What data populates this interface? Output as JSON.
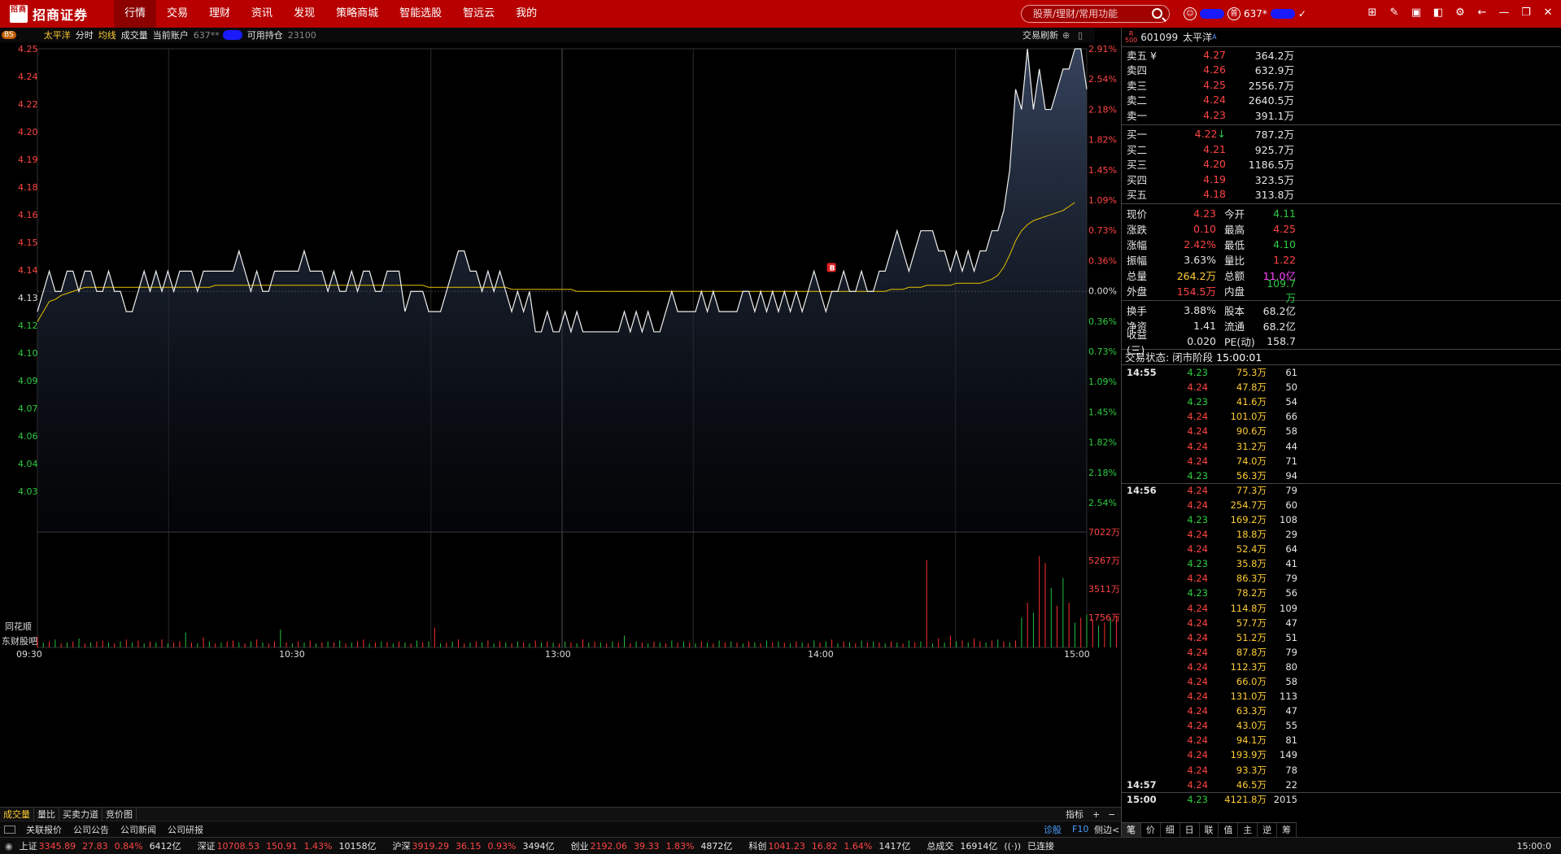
{
  "app": {
    "brand": "招商证券",
    "logo_text": "招商"
  },
  "menu": [
    "行情",
    "交易",
    "理财",
    "资讯",
    "发现",
    "策略商城",
    "智能选股",
    "智远云",
    "我的"
  ],
  "search": {
    "placeholder": "股票/理财/常用功能"
  },
  "account": {
    "id_prefix": "637*"
  },
  "infobar": {
    "stock": "太平洋",
    "items": [
      "分时",
      "均线",
      "成交量"
    ],
    "account_label": "当前账户",
    "account_prefix": "637**",
    "holding_label": "可用持仓",
    "holding": "23100",
    "refresh": "交易刷新",
    "bs": "BS"
  },
  "chart_data": {
    "type": "line",
    "title": "",
    "x_ticks": [
      "09:30",
      "10:30",
      "13:00",
      "14:00",
      "15:00"
    ],
    "y_left_ticks": [
      "4.25",
      "4.24",
      "4.22",
      "4.20",
      "4.19",
      "4.18",
      "4.16",
      "4.15",
      "4.14",
      "4.13",
      "4.12",
      "4.10",
      "4.09",
      "4.07",
      "4.06",
      "4.04",
      "4.03"
    ],
    "y_right_ticks": [
      "2.91%",
      "2.54%",
      "2.18%",
      "1.82%",
      "1.45%",
      "1.09%",
      "0.73%",
      "0.36%",
      "0.00%",
      "0.36%",
      "0.73%",
      "1.09%",
      "1.45%",
      "1.82%",
      "2.18%",
      "2.54%"
    ],
    "vol_ticks": [
      "7022万",
      "5267万",
      "3511万",
      "1756万"
    ],
    "prev_close": 4.13,
    "ylim": [
      4.011,
      4.25
    ],
    "price": [
      4.12,
      4.13,
      4.14,
      4.13,
      4.13,
      4.14,
      4.14,
      4.13,
      4.14,
      4.14,
      4.13,
      4.13,
      4.14,
      4.13,
      4.13,
      4.12,
      4.12,
      4.13,
      4.14,
      4.13,
      4.14,
      4.13,
      4.14,
      4.13,
      4.14,
      4.14,
      4.14,
      4.13,
      4.14,
      4.14,
      4.14,
      4.14,
      4.14,
      4.14,
      4.15,
      4.14,
      4.13,
      4.14,
      4.13,
      4.13,
      4.14,
      4.14,
      4.14,
      4.14,
      4.14,
      4.15,
      4.14,
      4.14,
      4.14,
      4.13,
      4.14,
      4.13,
      4.13,
      4.14,
      4.13,
      4.14,
      4.14,
      4.13,
      4.13,
      4.14,
      4.14,
      4.14,
      4.12,
      4.13,
      4.13,
      4.13,
      4.12,
      4.12,
      4.12,
      4.13,
      4.14,
      4.15,
      4.15,
      4.14,
      4.14,
      4.13,
      4.14,
      4.13,
      4.14,
      4.13,
      4.12,
      4.13,
      4.12,
      4.13,
      4.11,
      4.11,
      4.12,
      4.11,
      4.11,
      4.12,
      4.11,
      4.12,
      4.11,
      4.11,
      4.11,
      4.11,
      4.11,
      4.11,
      4.11,
      4.12,
      4.11,
      4.12,
      4.11,
      4.12,
      4.11,
      4.11,
      4.12,
      4.13,
      4.12,
      4.12,
      4.12,
      4.12,
      4.13,
      4.12,
      4.13,
      4.12,
      4.12,
      4.12,
      4.12,
      4.13,
      4.13,
      4.12,
      4.13,
      4.12,
      4.13,
      4.12,
      4.13,
      4.12,
      4.13,
      4.12,
      4.13,
      4.14,
      4.13,
      4.12,
      4.13,
      4.13,
      4.14,
      4.13,
      4.13,
      4.14,
      4.13,
      4.13,
      4.14,
      4.14,
      4.15,
      4.16,
      4.15,
      4.14,
      4.15,
      4.16,
      4.16,
      4.16,
      4.15,
      4.15,
      4.14,
      4.15,
      4.14,
      4.15,
      4.14,
      4.15,
      4.15,
      4.16,
      4.16,
      4.17,
      4.19,
      4.23,
      4.22,
      4.25,
      4.22,
      4.24,
      4.22,
      4.22,
      4.23,
      4.24,
      4.24,
      4.25,
      4.25,
      4.23
    ],
    "avg": [
      4.115,
      4.12,
      4.125,
      4.126,
      4.128,
      4.129,
      4.13,
      4.131,
      4.132,
      4.132,
      4.132,
      4.132,
      4.132,
      4.132,
      4.132,
      4.132,
      4.132,
      4.132,
      4.132,
      4.132,
      4.132,
      4.132,
      4.132,
      4.132,
      4.132,
      4.132,
      4.132,
      4.132,
      4.132,
      4.132,
      4.133,
      4.133,
      4.133,
      4.133,
      4.133,
      4.133,
      4.133,
      4.133,
      4.133,
      4.133,
      4.133,
      4.133,
      4.133,
      4.133,
      4.133,
      4.133,
      4.133,
      4.133,
      4.133,
      4.133,
      4.133,
      4.133,
      4.133,
      4.133,
      4.133,
      4.133,
      4.133,
      4.133,
      4.133,
      4.133,
      4.133,
      4.133,
      4.133,
      4.133,
      4.133,
      4.133,
      4.132,
      4.132,
      4.132,
      4.132,
      4.132,
      4.132,
      4.132,
      4.132,
      4.132,
      4.132,
      4.132,
      4.132,
      4.132,
      4.132,
      4.131,
      4.131,
      4.131,
      4.131,
      4.131,
      4.131,
      4.131,
      4.131,
      4.131,
      4.131,
      4.131,
      4.13,
      4.13,
      4.13,
      4.13,
      4.13,
      4.13,
      4.13,
      4.13,
      4.13,
      4.13,
      4.13,
      4.13,
      4.13,
      4.13,
      4.13,
      4.13,
      4.13,
      4.13,
      4.13,
      4.13,
      4.13,
      4.13,
      4.13,
      4.13,
      4.13,
      4.13,
      4.13,
      4.13,
      4.13,
      4.13,
      4.13,
      4.13,
      4.13,
      4.13,
      4.13,
      4.13,
      4.13,
      4.13,
      4.13,
      4.13,
      4.13,
      4.13,
      4.13,
      4.13,
      4.13,
      4.13,
      4.13,
      4.13,
      4.13,
      4.13,
      4.13,
      4.13,
      4.13,
      4.131,
      4.131,
      4.131,
      4.132,
      4.132,
      4.132,
      4.133,
      4.133,
      4.133,
      4.133,
      4.133,
      4.134,
      4.134,
      4.134,
      4.134,
      4.134,
      4.135,
      4.136,
      4.138,
      4.142,
      4.148,
      4.155,
      4.16,
      4.163,
      4.165,
      4.166,
      4.167,
      4.168,
      4.169,
      4.17,
      4.172,
      4.174
    ],
    "volume": [
      0.11,
      0.05,
      0.06,
      0.08,
      0.04,
      0.05,
      0.06,
      0.09,
      0.04,
      0.05,
      0.06,
      0.07,
      0.05,
      0.04,
      0.06,
      0.08,
      0.05,
      0.07,
      0.04,
      0.06,
      0.05,
      0.08,
      0.04,
      0.05,
      0.06,
      0.15,
      0.05,
      0.04,
      0.1,
      0.06,
      0.04,
      0.05,
      0.06,
      0.07,
      0.05,
      0.04,
      0.06,
      0.08,
      0.05,
      0.04,
      0.06,
      0.18,
      0.05,
      0.04,
      0.06,
      0.05,
      0.07,
      0.04,
      0.05,
      0.06,
      0.05,
      0.07,
      0.04,
      0.05,
      0.06,
      0.08,
      0.04,
      0.05,
      0.06,
      0.05,
      0.04,
      0.06,
      0.05,
      0.04,
      0.07,
      0.05,
      0.06,
      0.2,
      0.04,
      0.05,
      0.06,
      0.08,
      0.04,
      0.05,
      0.06,
      0.05,
      0.07,
      0.04,
      0.06,
      0.05,
      0.04,
      0.06,
      0.05,
      0.04,
      0.07,
      0.05,
      0.06,
      0.05,
      0.04,
      0.06,
      0.05,
      0.04,
      0.08,
      0.05,
      0.06,
      0.05,
      0.04,
      0.06,
      0.05,
      0.12,
      0.04,
      0.06,
      0.05,
      0.04,
      0.06,
      0.05,
      0.04,
      0.07,
      0.05,
      0.06,
      0.05,
      0.04,
      0.06,
      0.05,
      0.04,
      0.07,
      0.05,
      0.06,
      0.05,
      0.04,
      0.06,
      0.05,
      0.04,
      0.07,
      0.05,
      0.06,
      0.05,
      0.04,
      0.06,
      0.05,
      0.04,
      0.07,
      0.05,
      0.06,
      0.08,
      0.04,
      0.06,
      0.05,
      0.04,
      0.07,
      0.05,
      0.06,
      0.05,
      0.04,
      0.06,
      0.05,
      0.04,
      0.07,
      0.05,
      0.06,
      0.88,
      0.04,
      0.09,
      0.05,
      0.12,
      0.06,
      0.07,
      0.05,
      0.09,
      0.06,
      0.05,
      0.07,
      0.08,
      0.06,
      0.05,
      0.07,
      0.3,
      0.45,
      0.35,
      0.92,
      0.85,
      0.6,
      0.42,
      0.7,
      0.45,
      0.25,
      0.3,
      0.33,
      0.28,
      0.22,
      0.25,
      0.3,
      0.32
    ],
    "vol_up": [
      1,
      0,
      1,
      0,
      1,
      0,
      1,
      0,
      1,
      0,
      1,
      1,
      0,
      1,
      0,
      1,
      0,
      1,
      0,
      1,
      0,
      1,
      0,
      1,
      1,
      0,
      1,
      0,
      1,
      0,
      1,
      0,
      1,
      1,
      0,
      1,
      0,
      1,
      0,
      1,
      1,
      0,
      1,
      0,
      1,
      0,
      1,
      0,
      1,
      0,
      1,
      0,
      1,
      0,
      1,
      1,
      0,
      1,
      0,
      1,
      0,
      1,
      0,
      1,
      0,
      1,
      0,
      1,
      0,
      1,
      0,
      1,
      1,
      0,
      1,
      0,
      1,
      0,
      1,
      0,
      1,
      0,
      1,
      0,
      1,
      0,
      1,
      0,
      1,
      0,
      1,
      0,
      1,
      0,
      1,
      0,
      1,
      0,
      1,
      0,
      1,
      0,
      1,
      0,
      1,
      0,
      1,
      0,
      1,
      0,
      1,
      0,
      1,
      0,
      1,
      0,
      1,
      0,
      1,
      0,
      1,
      0,
      1,
      0,
      1,
      0,
      1,
      0,
      1,
      0,
      1,
      0,
      1,
      0,
      1,
      0,
      1,
      0,
      1,
      0,
      1,
      0,
      1,
      0,
      1,
      0,
      1,
      0,
      1,
      0,
      1,
      0,
      1,
      0,
      1,
      0,
      1,
      0,
      1,
      1,
      0,
      1,
      0,
      1,
      0,
      1,
      0,
      1,
      0,
      1,
      1,
      0,
      1,
      0,
      1,
      0,
      1,
      0,
      1,
      0,
      1,
      0,
      1
    ],
    "marker": "B"
  },
  "left_side": [
    "同花顺",
    "东财股吧"
  ],
  "bottom_tabs": [
    "成交量",
    "量比",
    "买卖力道",
    "竞价图"
  ],
  "bottom_right": {
    "label": "指标",
    "plus": "+",
    "minus": "−"
  },
  "bottom_tabs2": [
    "关联报价",
    "公司公告",
    "公司新闻",
    "公司研报"
  ],
  "bottom_right2": [
    "诊股",
    "F10",
    "侧边<"
  ],
  "stock": {
    "code": "601099",
    "name": "太平洋",
    "flag": "A",
    "badge": "R",
    "badge2": "500"
  },
  "asks": [
    {
      "label": "卖五 ¥",
      "price": "4.27",
      "vol": "364.2万"
    },
    {
      "label": "卖四",
      "price": "4.26",
      "vol": "632.9万"
    },
    {
      "label": "卖三",
      "price": "4.25",
      "vol": "2556.7万"
    },
    {
      "label": "卖二",
      "price": "4.24",
      "vol": "2640.5万"
    },
    {
      "label": "卖一",
      "price": "4.23",
      "vol": "391.1万"
    }
  ],
  "bids": [
    {
      "label": "买一",
      "price": "4.22",
      "vol": "787.2万",
      "arrow": "↓"
    },
    {
      "label": "买二",
      "price": "4.21",
      "vol": "925.7万",
      "arrow": ""
    },
    {
      "label": "买三",
      "price": "4.20",
      "vol": "1186.5万",
      "arrow": ""
    },
    {
      "label": "买四",
      "price": "4.19",
      "vol": "323.5万",
      "arrow": ""
    },
    {
      "label": "买五",
      "price": "4.18",
      "vol": "313.8万",
      "arrow": ""
    }
  ],
  "quote1": [
    {
      "k1": "现价",
      "v1": "4.23",
      "c1": "red",
      "k2": "今开",
      "v2": "4.11",
      "c2": "grn"
    },
    {
      "k1": "涨跌",
      "v1": "0.10",
      "c1": "red",
      "k2": "最高",
      "v2": "4.25",
      "c2": "red"
    },
    {
      "k1": "涨幅",
      "v1": "2.42%",
      "c1": "red",
      "k2": "最低",
      "v2": "4.10",
      "c2": "grn"
    },
    {
      "k1": "振幅",
      "v1": "3.63%",
      "c1": "wht",
      "k2": "量比",
      "v2": "1.22",
      "c2": "red"
    },
    {
      "k1": "总量",
      "v1": "264.2万",
      "c1": "yel",
      "k2": "总额",
      "v2": "11.0亿",
      "c2": "pur"
    },
    {
      "k1": "外盘",
      "v1": "154.5万",
      "c1": "red",
      "k2": "内盘",
      "v2": "109.7万",
      "c2": "grn"
    }
  ],
  "quote2": [
    {
      "k1": "换手",
      "v1": "3.88%",
      "c1": "wht",
      "k2": "股本",
      "v2": "68.2亿",
      "c2": "wht"
    },
    {
      "k1": "净资",
      "v1": "1.41",
      "c1": "wht",
      "k2": "流通",
      "v2": "68.2亿",
      "c2": "wht"
    },
    {
      "k1": "收益(三)",
      "v1": "0.020",
      "c1": "wht",
      "k2": "PE(动)",
      "v2": "158.7",
      "c2": "wht"
    }
  ],
  "trade_state": {
    "label": "交易状态: 闭市阶段",
    "time": "15:00:01"
  },
  "ticks": [
    {
      "t": "14:55",
      "p": "4.23",
      "pc": "grn",
      "v": "75.3万",
      "n": "61"
    },
    {
      "t": "",
      "p": "4.24",
      "pc": "red",
      "v": "47.8万",
      "n": "50"
    },
    {
      "t": "",
      "p": "4.23",
      "pc": "grn",
      "v": "41.6万",
      "n": "54"
    },
    {
      "t": "",
      "p": "4.24",
      "pc": "red",
      "v": "101.0万",
      "n": "66"
    },
    {
      "t": "",
      "p": "4.24",
      "pc": "red",
      "v": "90.6万",
      "n": "58"
    },
    {
      "t": "",
      "p": "4.24",
      "pc": "red",
      "v": "31.2万",
      "n": "44"
    },
    {
      "t": "",
      "p": "4.24",
      "pc": "red",
      "v": "74.0万",
      "n": "71"
    },
    {
      "t": "",
      "p": "4.23",
      "pc": "grn",
      "v": "56.3万",
      "n": "94"
    },
    {
      "t": "14:56",
      "p": "4.24",
      "pc": "red",
      "v": "77.3万",
      "n": "79"
    },
    {
      "t": "",
      "p": "4.24",
      "pc": "red",
      "v": "254.7万",
      "n": "60"
    },
    {
      "t": "",
      "p": "4.23",
      "pc": "grn",
      "v": "169.2万",
      "n": "108"
    },
    {
      "t": "",
      "p": "4.24",
      "pc": "red",
      "v": "18.8万",
      "n": "29"
    },
    {
      "t": "",
      "p": "4.24",
      "pc": "red",
      "v": "52.4万",
      "n": "64"
    },
    {
      "t": "",
      "p": "4.23",
      "pc": "grn",
      "v": "35.8万",
      "n": "41"
    },
    {
      "t": "",
      "p": "4.24",
      "pc": "red",
      "v": "86.3万",
      "n": "79"
    },
    {
      "t": "",
      "p": "4.23",
      "pc": "grn",
      "v": "78.2万",
      "n": "56"
    },
    {
      "t": "",
      "p": "4.24",
      "pc": "red",
      "v": "114.8万",
      "n": "109"
    },
    {
      "t": "",
      "p": "4.24",
      "pc": "red",
      "v": "57.7万",
      "n": "47"
    },
    {
      "t": "",
      "p": "4.24",
      "pc": "red",
      "v": "51.2万",
      "n": "51"
    },
    {
      "t": "",
      "p": "4.24",
      "pc": "red",
      "v": "87.8万",
      "n": "79"
    },
    {
      "t": "",
      "p": "4.24",
      "pc": "red",
      "v": "112.3万",
      "n": "80"
    },
    {
      "t": "",
      "p": "4.24",
      "pc": "red",
      "v": "66.0万",
      "n": "58"
    },
    {
      "t": "",
      "p": "4.24",
      "pc": "red",
      "v": "131.0万",
      "n": "113"
    },
    {
      "t": "",
      "p": "4.24",
      "pc": "red",
      "v": "63.3万",
      "n": "47"
    },
    {
      "t": "",
      "p": "4.24",
      "pc": "red",
      "v": "43.0万",
      "n": "55"
    },
    {
      "t": "",
      "p": "4.24",
      "pc": "red",
      "v": "94.1万",
      "n": "81"
    },
    {
      "t": "",
      "p": "4.24",
      "pc": "red",
      "v": "193.9万",
      "n": "149"
    },
    {
      "t": "",
      "p": "4.24",
      "pc": "red",
      "v": "93.3万",
      "n": "78"
    },
    {
      "t": "14:57",
      "p": "4.24",
      "pc": "red",
      "v": "46.5万",
      "n": "22"
    },
    {
      "t": "15:00",
      "p": "4.23",
      "pc": "grn",
      "v": "4121.8万",
      "n": "2015"
    }
  ],
  "right_tabs": [
    "笔",
    "价",
    "细",
    "日",
    "联",
    "值",
    "主",
    "逆",
    "筹"
  ],
  "status": [
    {
      "name": "上证",
      "val": "3345.89",
      "chg": "27.83",
      "pct": "0.84%",
      "amt": "6412亿"
    },
    {
      "name": "深证",
      "val": "10708.53",
      "chg": "150.91",
      "pct": "1.43%",
      "amt": "10158亿"
    },
    {
      "name": "沪深",
      "val": "3919.29",
      "chg": "36.15",
      "pct": "0.93%",
      "amt": "3494亿"
    },
    {
      "name": "创业",
      "val": "2192.06",
      "chg": "39.33",
      "pct": "1.83%",
      "amt": "4872亿"
    },
    {
      "name": "科创",
      "val": "1041.23",
      "chg": "16.82",
      "pct": "1.64%",
      "amt": "1417亿"
    }
  ],
  "status_total": {
    "label": "总成交",
    "amt": "16914亿",
    "conn": "已连接",
    "time": "15:00:0"
  }
}
